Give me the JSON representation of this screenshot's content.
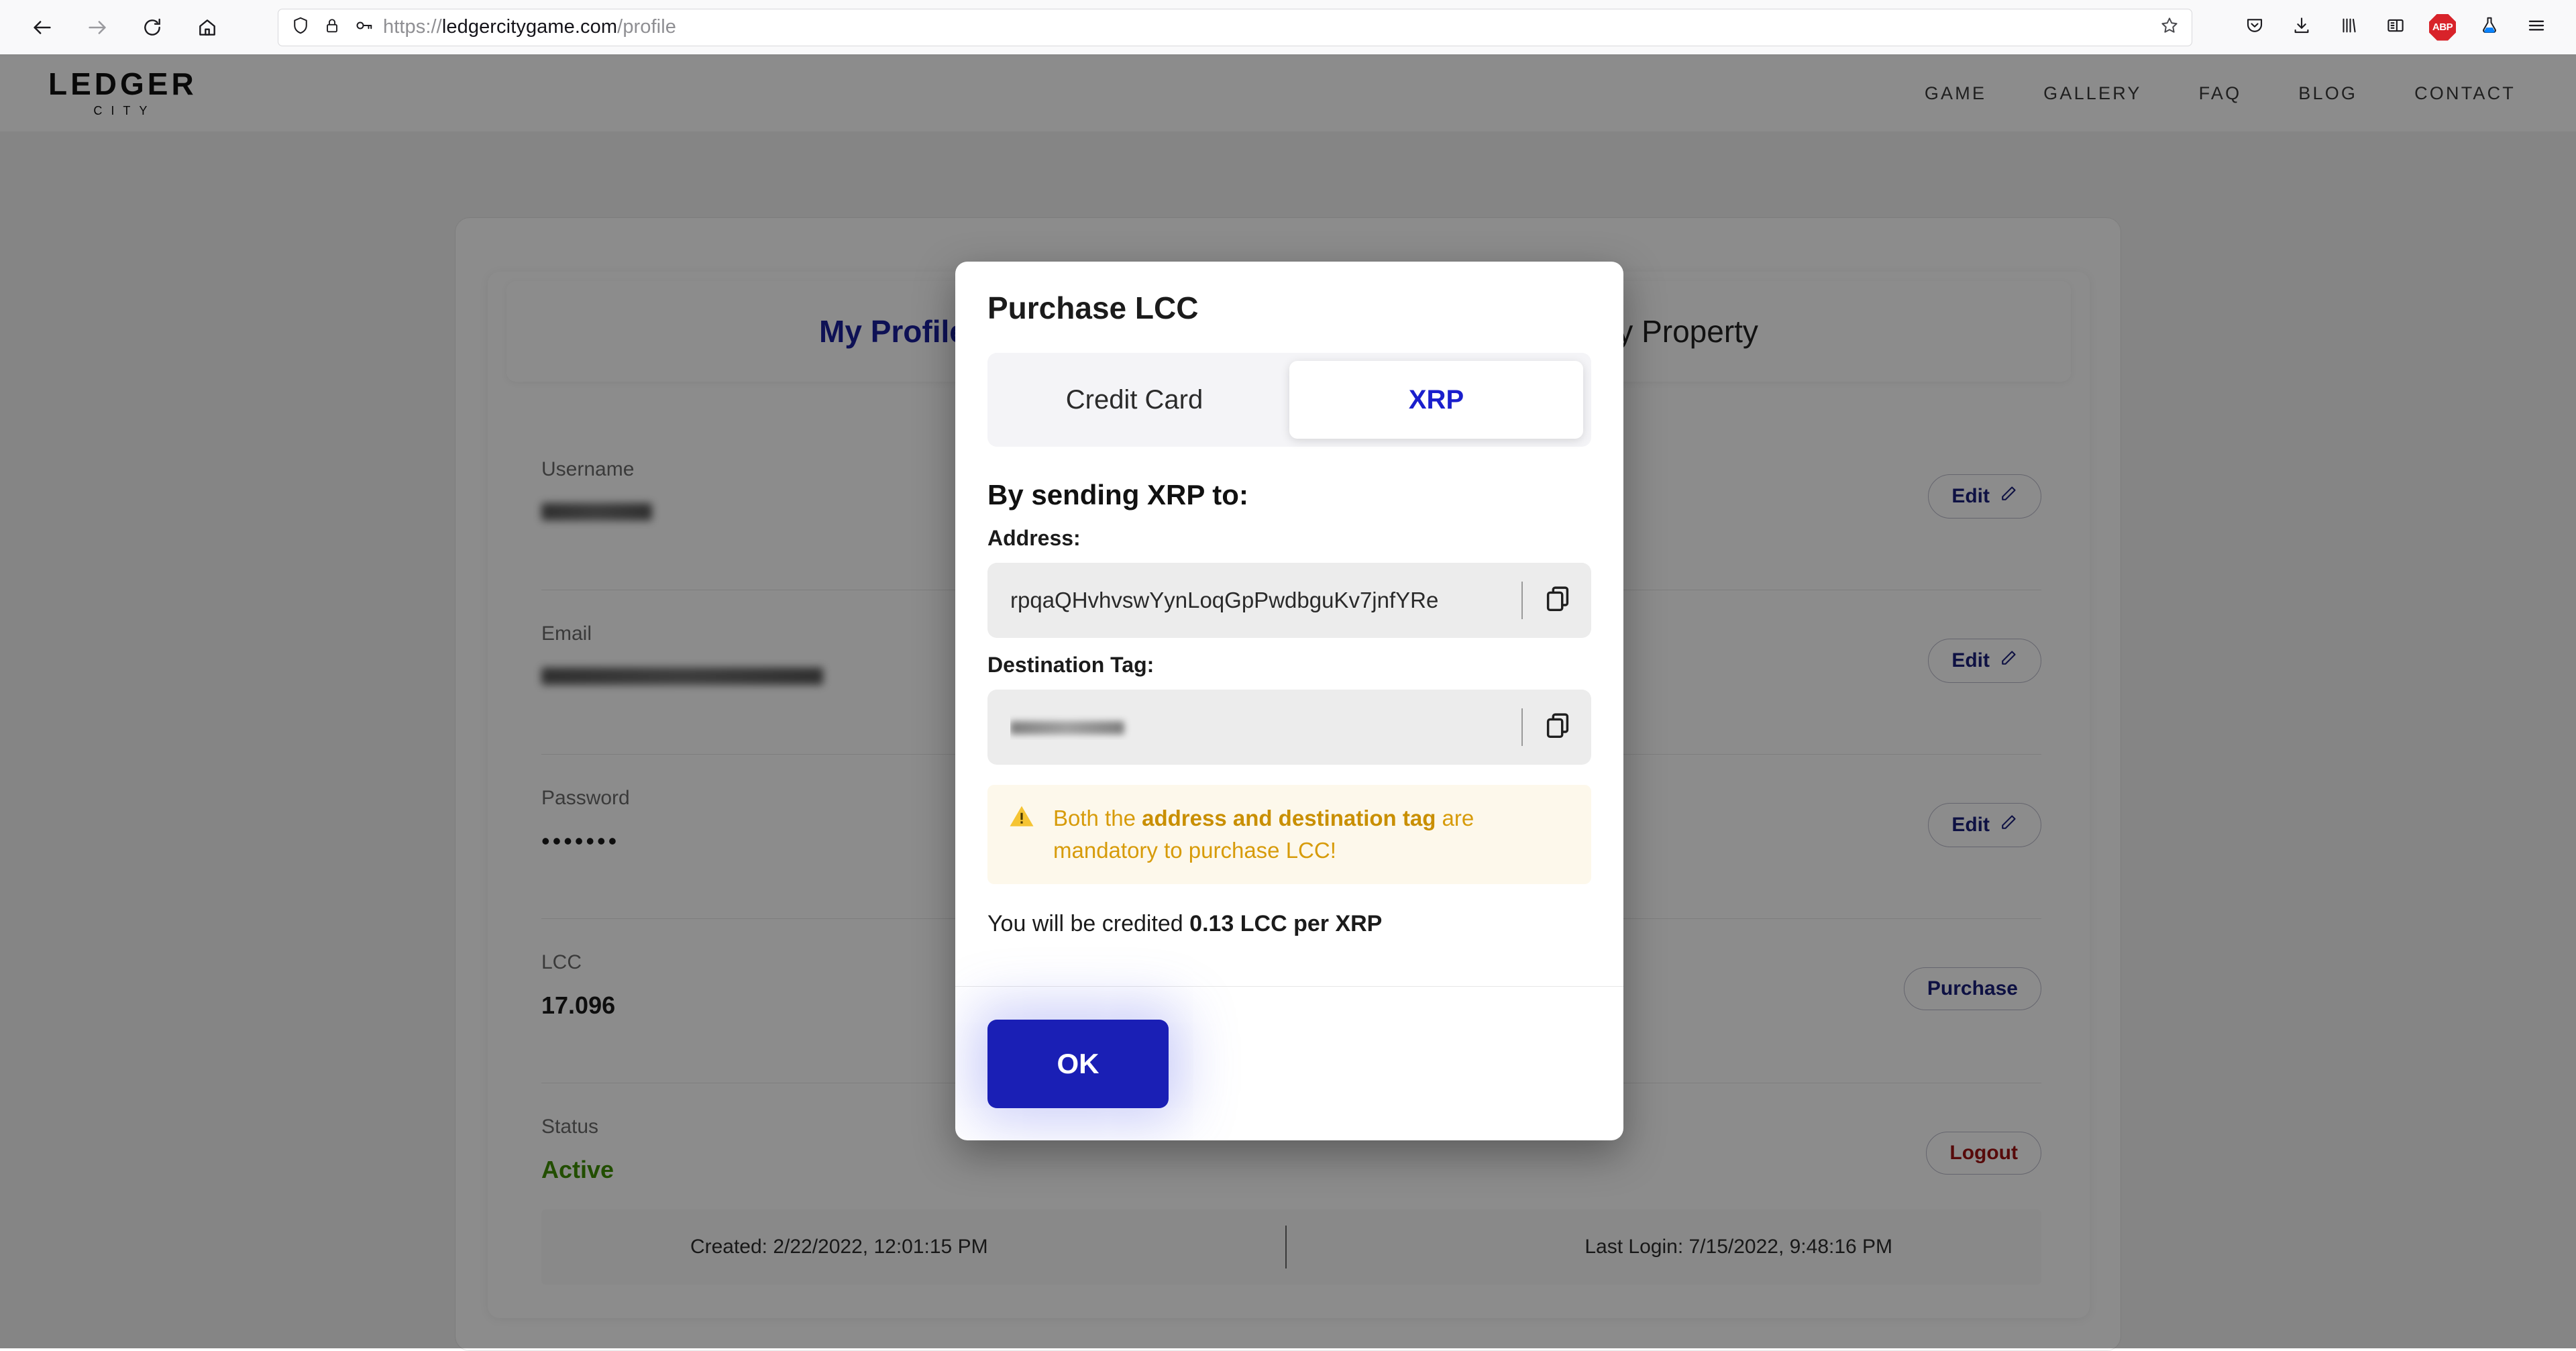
{
  "browser": {
    "url_prefix": "https://",
    "url_domain": "ledgercitygame.com",
    "url_path": "/profile",
    "icons": {
      "back": "back-arrow-icon",
      "forward": "forward-arrow-icon",
      "reload": "reload-icon",
      "home": "home-icon",
      "shield": "shield-icon",
      "lock": "lock-icon",
      "key": "key-icon",
      "bookmark": "star-icon",
      "pocket": "pocket-icon",
      "downloads": "download-icon",
      "library": "library-icon",
      "sidebar": "sidebar-icon",
      "adblock": "ABP",
      "flask": "flask-icon",
      "menu": "hamburger-menu-icon"
    }
  },
  "site": {
    "logo_main": "LEDGER",
    "logo_sub": "CITY",
    "nav": [
      "GAME",
      "GALLERY",
      "FAQ",
      "BLOG",
      "CONTACT"
    ]
  },
  "profile": {
    "tabs": [
      {
        "label": "My Profile",
        "active": true
      },
      {
        "label": "My Property",
        "active": false
      }
    ],
    "rows": [
      {
        "label": "Username",
        "value": "",
        "redacted": true,
        "redact_width": "w1",
        "action": "Edit",
        "action_icon": "pencil-icon",
        "action_kind": "edit"
      },
      {
        "label": "Email",
        "value": "",
        "redacted": true,
        "redact_width": "w2",
        "action": "Edit",
        "action_icon": "pencil-icon",
        "action_kind": "edit"
      },
      {
        "label": "Password",
        "value": "•••••••",
        "redacted": false,
        "action": "Edit",
        "action_icon": "pencil-icon",
        "action_kind": "edit"
      },
      {
        "label": "LCC",
        "value": "17.096",
        "redacted": false,
        "action": "Purchase",
        "action_icon": "",
        "action_kind": "purchase"
      },
      {
        "label": "Status",
        "value": "Active",
        "redacted": false,
        "action": "Logout",
        "action_icon": "",
        "action_kind": "logout"
      }
    ],
    "footer": {
      "created": "Created: 2/22/2022, 12:01:15 PM",
      "last_login": "Last Login: 7/15/2022, 9:48:16 PM"
    }
  },
  "modal": {
    "title": "Purchase LCC",
    "tabs": [
      {
        "label": "Credit Card",
        "active": false
      },
      {
        "label": "XRP",
        "active": true
      }
    ],
    "section_heading": "By sending XRP to:",
    "address_label": "Address:",
    "address_value": "rpqaQHvhvswYynLoqGpPwdbguKv7jnfYRe",
    "destination_tag_label": "Destination Tag:",
    "destination_tag_value": "",
    "destination_tag_redacted": true,
    "copy_icon": "copy-icon",
    "warning_icon": "warning-triangle-icon",
    "warning_prefix": "Both the ",
    "warning_bold": "address and destination tag",
    "warning_suffix": " are mandatory to purchase LCC!",
    "credit_prefix": "You will be credited ",
    "credit_bold": "0.13 LCC per XRP",
    "ok_label": "OK"
  },
  "colors": {
    "accent_blue": "#1a1fb5",
    "tab_blue": "#1a1f9c",
    "warning_amber": "#d79b0a",
    "status_green": "#3f8f00",
    "logout_red": "#9e1313"
  }
}
